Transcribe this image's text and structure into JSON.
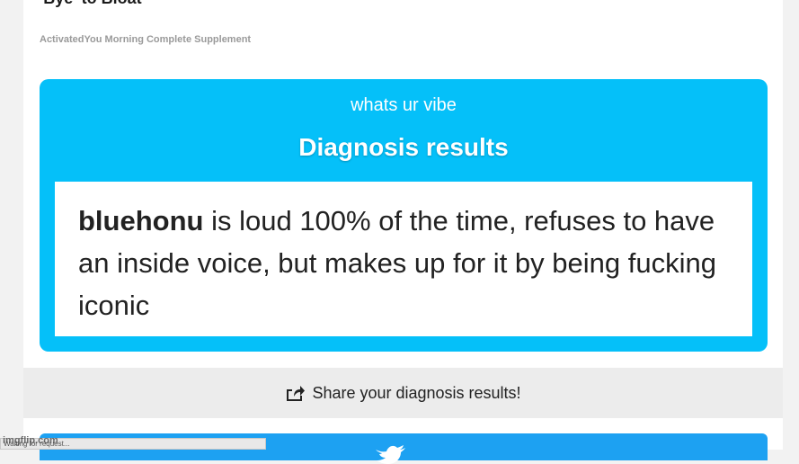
{
  "ad": {
    "title": "'Bye' to Bloat",
    "source": "ActivatedYou Morning Complete Supplement"
  },
  "result_card": {
    "subtitle": "whats ur vibe",
    "title": "Diagnosis results",
    "name": "bluehonu",
    "text": " is loud 100% of the time, refuses to have an inside voice, but makes up for it by being fucking iconic"
  },
  "share": {
    "label": "Share your diagnosis results!",
    "icon": "share-icon"
  },
  "twitter": {
    "icon": "twitter-bird-icon"
  },
  "status_bar": {
    "text": "Waiting for request..."
  },
  "watermark": {
    "text": "imgflip.com"
  },
  "colors": {
    "card": "#05c0f9",
    "share_bg": "#ececec",
    "twitter": "#1da1f2"
  }
}
